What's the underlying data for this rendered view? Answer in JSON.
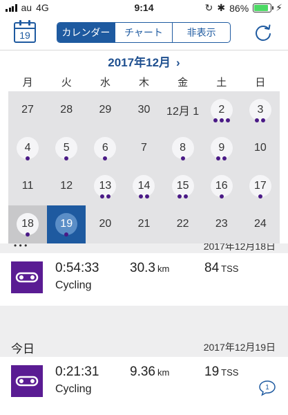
{
  "status_bar": {
    "carrier": "au",
    "network": "4G",
    "time": "9:14",
    "battery": "86%",
    "battery_level": 0.86
  },
  "toolbar": {
    "calendar_icon_day": "19",
    "tabs": [
      {
        "label": "カレンダー",
        "active": true
      },
      {
        "label": "チャート",
        "active": false
      },
      {
        "label": "非表示",
        "active": false
      }
    ],
    "refresh_icon": "refresh-icon"
  },
  "calendar": {
    "month_title": "2017年12月",
    "next_icon": "chevron-right-icon",
    "weekdays": [
      "月",
      "火",
      "水",
      "木",
      "金",
      "土",
      "日"
    ],
    "weeks": [
      [
        {
          "label": "27",
          "dots": 0
        },
        {
          "label": "28",
          "dots": 0
        },
        {
          "label": "29",
          "dots": 0
        },
        {
          "label": "30",
          "dots": 0
        },
        {
          "label": "12月 1",
          "dots": 0
        },
        {
          "label": "2",
          "dots": 3
        },
        {
          "label": "3",
          "dots": 2
        }
      ],
      [
        {
          "label": "4",
          "dots": 1
        },
        {
          "label": "5",
          "dots": 1
        },
        {
          "label": "6",
          "dots": 1
        },
        {
          "label": "7",
          "dots": 0
        },
        {
          "label": "8",
          "dots": 1
        },
        {
          "label": "9",
          "dots": 2
        },
        {
          "label": "10",
          "dots": 0
        }
      ],
      [
        {
          "label": "11",
          "dots": 0
        },
        {
          "label": "12",
          "dots": 0
        },
        {
          "label": "13",
          "dots": 2
        },
        {
          "label": "14",
          "dots": 2
        },
        {
          "label": "15",
          "dots": 2
        },
        {
          "label": "16",
          "dots": 1
        },
        {
          "label": "17",
          "dots": 1
        }
      ],
      [
        {
          "label": "18",
          "dots": 1,
          "state": "prev"
        },
        {
          "label": "19",
          "dots": 1,
          "state": "selected"
        },
        {
          "label": "20",
          "dots": 0
        },
        {
          "label": "21",
          "dots": 0
        },
        {
          "label": "22",
          "dots": 0
        },
        {
          "label": "23",
          "dots": 0
        },
        {
          "label": "24",
          "dots": 0
        }
      ]
    ]
  },
  "list": {
    "partial_header_date": "2017年12月18日",
    "sections": [
      {
        "activity": {
          "icon": "bike-chain-icon",
          "duration": "0:54:33",
          "type": "Cycling",
          "distance": "30.3",
          "distance_unit": "km",
          "tss": "84",
          "tss_unit": "TSS"
        }
      },
      {
        "label": "今日",
        "date": "2017年12月19日",
        "activity": {
          "icon": "bike-chain-icon",
          "duration": "0:21:31",
          "type": "Cycling",
          "distance": "9.36",
          "distance_unit": "km",
          "tss": "19",
          "tss_unit": "TSS",
          "comment_count": "1",
          "comment_icon": "comment-bubble-icon"
        }
      }
    ]
  },
  "colors": {
    "accent": "#1e5aa0",
    "activity": "#5a1c93",
    "dot": "#4a1a86",
    "calendar_bg": "#e3e3e5"
  }
}
